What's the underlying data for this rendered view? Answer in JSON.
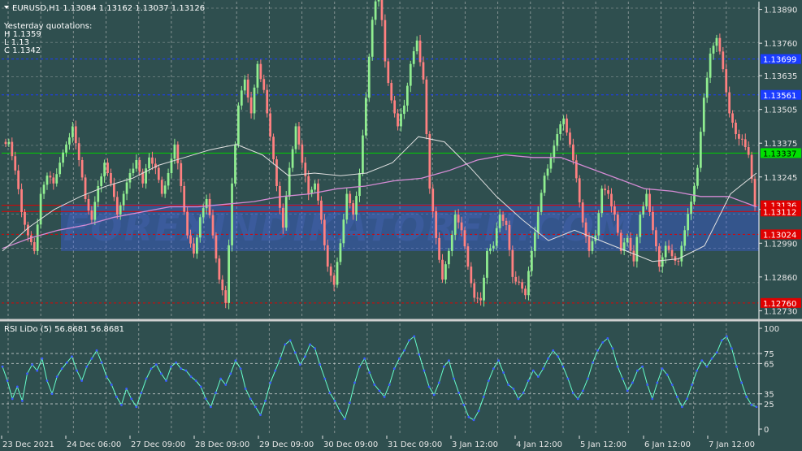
{
  "colors": {
    "background": "#2f4f4f",
    "bull": "#90ee90",
    "bear": "#ff8080",
    "grid": "#c8c8c8",
    "ma_slow": "#d48bd4",
    "ma_fast": "#e0e0e0",
    "rsi_line": "#66ffcc",
    "rsi_dot": "#3b5bff",
    "level_blue": "#1a3cff",
    "level_green": "#00d000",
    "level_red": "#e00000",
    "band": "#4060ff",
    "label_blue": "#1a3cff",
    "label_green": "#00e000",
    "label_red": "#e00000"
  },
  "header": {
    "symbol_info": "EURUSD,H1  1.13084 1.13162 1.13037 1.13126",
    "quote_title": "Yesterday quotations:",
    "high": "H 1.1359",
    "low": "L 1.13",
    "close": "C 1.1342"
  },
  "watermark": "FOREXINDIKATOREN.COM",
  "chart_data": [
    {
      "type": "candlestick",
      "title": "EURUSD,H1",
      "ohlc_header": [
        1.13084,
        1.13162,
        1.13037,
        1.13126
      ],
      "price_ticks": [
        "1.13890",
        "1.13760",
        "1.13635",
        "1.13505",
        "1.13375",
        "1.13245",
        "1.13120",
        "1.12990",
        "1.12860",
        "1.12730"
      ],
      "y_range": [
        1.127,
        1.1392
      ],
      "levels": [
        {
          "price": 1.13699,
          "label": "1.13699",
          "color": "blue",
          "style": "dashed"
        },
        {
          "price": 1.13561,
          "label": "1.13561",
          "color": "blue",
          "style": "dashed"
        },
        {
          "price": 1.13337,
          "label": "1.13337",
          "color": "green",
          "style": "solid"
        },
        {
          "price": 1.13136,
          "label": "1.13136",
          "color": "red",
          "style": "solid"
        },
        {
          "price": 1.13112,
          "label": "1.13112",
          "color": "red",
          "style": "solid"
        },
        {
          "price": 1.13024,
          "label": "1.13024",
          "color": "red",
          "style": "dashed"
        },
        {
          "price": 1.1276,
          "label": "1.12760",
          "color": "red",
          "style": "dashed"
        }
      ],
      "band_range": [
        1.1296,
        1.1314
      ],
      "close_path": [
        1.1338,
        1.1327,
        1.1311,
        1.1302,
        1.1296,
        1.1318,
        1.1325,
        1.1322,
        1.133,
        1.1337,
        1.1344,
        1.1331,
        1.1316,
        1.1308,
        1.1321,
        1.133,
        1.1322,
        1.131,
        1.1318,
        1.1326,
        1.1331,
        1.1322,
        1.1332,
        1.1328,
        1.1318,
        1.1326,
        1.1337,
        1.1321,
        1.1302,
        1.1295,
        1.1309,
        1.1316,
        1.1302,
        1.1285,
        1.1276,
        1.1322,
        1.1352,
        1.1362,
        1.1349,
        1.1368,
        1.1358,
        1.134,
        1.1321,
        1.1305,
        1.1328,
        1.1344,
        1.133,
        1.1318,
        1.1322,
        1.1308,
        1.129,
        1.1283,
        1.1299,
        1.1318,
        1.131,
        1.1326,
        1.1355,
        1.1385,
        1.14,
        1.1369,
        1.1354,
        1.1344,
        1.1352,
        1.1368,
        1.1377,
        1.1362,
        1.132,
        1.1301,
        1.1285,
        1.1296,
        1.131,
        1.1304,
        1.129,
        1.1278,
        1.1277,
        1.1296,
        1.1298,
        1.131,
        1.1306,
        1.1286,
        1.1284,
        1.1279,
        1.1296,
        1.1311,
        1.1325,
        1.1332,
        1.1341,
        1.1347,
        1.1337,
        1.1324,
        1.1307,
        1.1296,
        1.1302,
        1.132,
        1.1318,
        1.131,
        1.1296,
        1.1301,
        1.1292,
        1.131,
        1.1318,
        1.1304,
        1.129,
        1.1298,
        1.1294,
        1.1292,
        1.1304,
        1.1315,
        1.1328,
        1.1355,
        1.1372,
        1.1378,
        1.1366,
        1.1349,
        1.1341,
        1.1339,
        1.1333,
        1.1313
      ],
      "slow_ma": [
        1.1297,
        1.1301,
        1.1304,
        1.1306,
        1.1309,
        1.1311,
        1.1313,
        1.1313,
        1.1314,
        1.1315,
        1.1317,
        1.1318,
        1.132,
        1.1321,
        1.1323,
        1.1324,
        1.1327,
        1.1331,
        1.1333,
        1.1332,
        1.1332,
        1.1328,
        1.1324,
        1.132,
        1.1319,
        1.1317,
        1.1317,
        1.1313
      ],
      "fast_ma": [
        1.1296,
        1.1305,
        1.1312,
        1.1317,
        1.1321,
        1.1324,
        1.1329,
        1.1332,
        1.1335,
        1.1337,
        1.1333,
        1.1325,
        1.1326,
        1.1325,
        1.1326,
        1.133,
        1.134,
        1.1338,
        1.1328,
        1.1317,
        1.1308,
        1.13,
        1.1304,
        1.13,
        1.1296,
        1.1292,
        1.1293,
        1.1298,
        1.1318,
        1.1326
      ]
    },
    {
      "type": "line",
      "title": "RSI LiDo (5) 56.8681 56.8681",
      "y_ticks": [
        "100",
        "75",
        "65",
        "35",
        "25",
        "0"
      ],
      "y_range": [
        0,
        100
      ],
      "dashed_levels": [
        75,
        65,
        35,
        25
      ],
      "values": [
        62,
        48,
        30,
        42,
        28,
        55,
        64,
        58,
        70,
        48,
        35,
        52,
        60,
        66,
        72,
        58,
        48,
        62,
        70,
        78,
        66,
        52,
        44,
        32,
        24,
        40,
        30,
        22,
        36,
        50,
        60,
        64,
        55,
        48,
        62,
        66,
        60,
        58,
        52,
        48,
        42,
        30,
        22,
        36,
        50,
        44,
        55,
        68,
        60,
        40,
        30,
        22,
        14,
        28,
        46,
        58,
        70,
        84,
        88,
        76,
        64,
        72,
        84,
        80,
        64,
        50,
        36,
        28,
        18,
        10,
        26,
        46,
        62,
        70,
        56,
        44,
        38,
        32,
        44,
        60,
        70,
        78,
        88,
        92,
        74,
        58,
        42,
        34,
        46,
        62,
        68,
        50,
        36,
        24,
        12,
        9,
        18,
        32,
        48,
        60,
        68,
        56,
        44,
        40,
        30,
        36,
        48,
        58,
        52,
        60,
        70,
        78,
        72,
        62,
        50,
        36,
        30,
        38,
        50,
        66,
        78,
        86,
        90,
        80,
        62,
        50,
        38,
        46,
        58,
        62,
        44,
        30,
        46,
        60,
        54,
        44,
        32,
        22,
        30,
        44,
        58,
        68,
        62,
        70,
        76,
        88,
        92,
        80,
        62,
        46,
        32,
        24,
        22
      ],
      "value_labels": {
        "rsi_name": "RSI LiDo (5)",
        "value1": 56.8681,
        "value2": 56.8681
      }
    }
  ],
  "time_axis": [
    "23 Dec 2021",
    "24 Dec 06:00",
    "27 Dec 09:00",
    "28 Dec 09:00",
    "29 Dec 09:00",
    "30 Dec 09:00",
    "31 Dec 09:00",
    "3 Jan 12:00",
    "4 Jan 12:00",
    "5 Jan 12:00",
    "6 Jan 12:00",
    "7 Jan 12:00"
  ]
}
